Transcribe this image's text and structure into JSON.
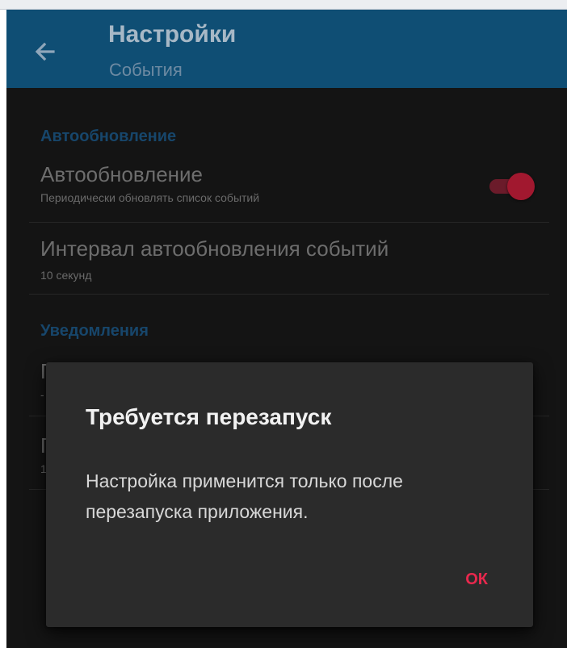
{
  "toolbar": {
    "title": "Настройки",
    "subtitle": "События",
    "back_icon": "arrow-left-icon",
    "background": "#0f4e74"
  },
  "sections": {
    "autoupdate": {
      "header": "Автообновление",
      "items": [
        {
          "title": "Автообновление",
          "summary": "Периодически обновлять список событий",
          "switch_on": true
        },
        {
          "title": "Интервал автообновления событий",
          "summary": "10 секунд"
        }
      ]
    },
    "notifications": {
      "header": "Уведомления",
      "partial_items": [
        {
          "title_fragment": "П",
          "summary_fragment": "‐"
        },
        {
          "title_fragment": "П",
          "summary_fragment": "1"
        }
      ]
    }
  },
  "dialog": {
    "title": "Требуется перезапуск",
    "message": "Настройка применится только после перезапуска приложения.",
    "ok_label": "ОК",
    "accent": "#e8284d"
  },
  "colors": {
    "section_header": "#17466b",
    "switch_thumb": "#a1182f",
    "screen_background": "#141414"
  }
}
